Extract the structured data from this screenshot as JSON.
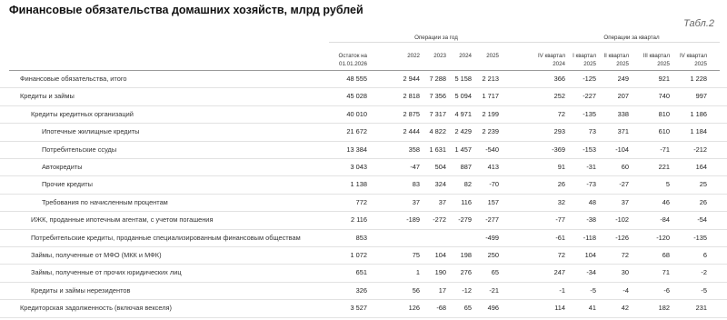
{
  "title": "Финансовые обязательства домашних хозяйств, млрд рублей",
  "table_label": "Табл.2",
  "header": {
    "balance_line1": "Остаток на",
    "balance_line2": "01.01.2026",
    "group_year": "Операции за год",
    "group_quarter": "Операции за квартал",
    "years": [
      "2022",
      "2023",
      "2024",
      "2025"
    ],
    "quarters": [
      {
        "l1": "IV квартал",
        "l2": "2024"
      },
      {
        "l1": "I квартал",
        "l2": "2025"
      },
      {
        "l1": "II квартал",
        "l2": "2025"
      },
      {
        "l1": "III квартал",
        "l2": "2025"
      },
      {
        "l1": "IV квартал",
        "l2": "2025"
      }
    ]
  },
  "rows": [
    {
      "label": "Финансовые обязательства, итого",
      "level": 0,
      "values": [
        "48 555",
        "2 944",
        "7 288",
        "5 158",
        "2 213",
        "366",
        "-125",
        "249",
        "921",
        "1 228"
      ]
    },
    {
      "label": "Кредиты и займы",
      "level": 0,
      "values": [
        "45 028",
        "2 818",
        "7 356",
        "5 094",
        "1 717",
        "252",
        "-227",
        "207",
        "740",
        "997"
      ]
    },
    {
      "label": "Кредиты кредитных организаций",
      "level": 1,
      "values": [
        "40 010",
        "2 875",
        "7 317",
        "4 971",
        "2 199",
        "72",
        "-135",
        "338",
        "810",
        "1 186"
      ]
    },
    {
      "label": "Ипотечные жилищные кредиты",
      "level": 2,
      "values": [
        "21 672",
        "2 444",
        "4 822",
        "2 429",
        "2 239",
        "293",
        "73",
        "371",
        "610",
        "1 184"
      ]
    },
    {
      "label": "Потребительские ссуды",
      "level": 2,
      "values": [
        "13 384",
        "358",
        "1 631",
        "1 457",
        "-540",
        "-369",
        "-153",
        "-104",
        "-71",
        "-212"
      ]
    },
    {
      "label": "Автокредиты",
      "level": 2,
      "values": [
        "3 043",
        "-47",
        "504",
        "887",
        "413",
        "91",
        "-31",
        "60",
        "221",
        "164"
      ]
    },
    {
      "label": "Прочие кредиты",
      "level": 2,
      "values": [
        "1 138",
        "83",
        "324",
        "82",
        "-70",
        "26",
        "-73",
        "-27",
        "5",
        "25"
      ]
    },
    {
      "label": "Требования по начисленным процентам",
      "level": 2,
      "values": [
        "772",
        "37",
        "37",
        "116",
        "157",
        "32",
        "48",
        "37",
        "46",
        "26"
      ]
    },
    {
      "label": "ИЖК, проданные ипотечным агентам, с учетом погашения",
      "level": 1,
      "values": [
        "2 116",
        "-189",
        "-272",
        "-279",
        "-277",
        "-77",
        "-38",
        "-102",
        "-84",
        "-54"
      ]
    },
    {
      "label": "Потребительские кредиты, проданные специализированным финансовым обществам",
      "level": 1,
      "values": [
        "853",
        "",
        "",
        "",
        "-499",
        "-61",
        "-118",
        "-126",
        "-120",
        "-135"
      ]
    },
    {
      "label": "Займы, полученные от МФО (МКК и МФК)",
      "level": 1,
      "values": [
        "1 072",
        "75",
        "104",
        "198",
        "250",
        "72",
        "104",
        "72",
        "68",
        "6"
      ]
    },
    {
      "label": "Займы, полученные от прочих юридических лиц",
      "level": 1,
      "values": [
        "651",
        "1",
        "190",
        "276",
        "65",
        "247",
        "-34",
        "30",
        "71",
        "-2"
      ]
    },
    {
      "label": "Кредиты и займы нерезидентов",
      "level": 1,
      "values": [
        "326",
        "56",
        "17",
        "-12",
        "-21",
        "-1",
        "-5",
        "-4",
        "-6",
        "-5"
      ]
    },
    {
      "label": "Кредиторская задолженность (включая векселя)",
      "level": 0,
      "values": [
        "3 527",
        "126",
        "-68",
        "65",
        "496",
        "114",
        "41",
        "42",
        "182",
        "231"
      ]
    }
  ]
}
